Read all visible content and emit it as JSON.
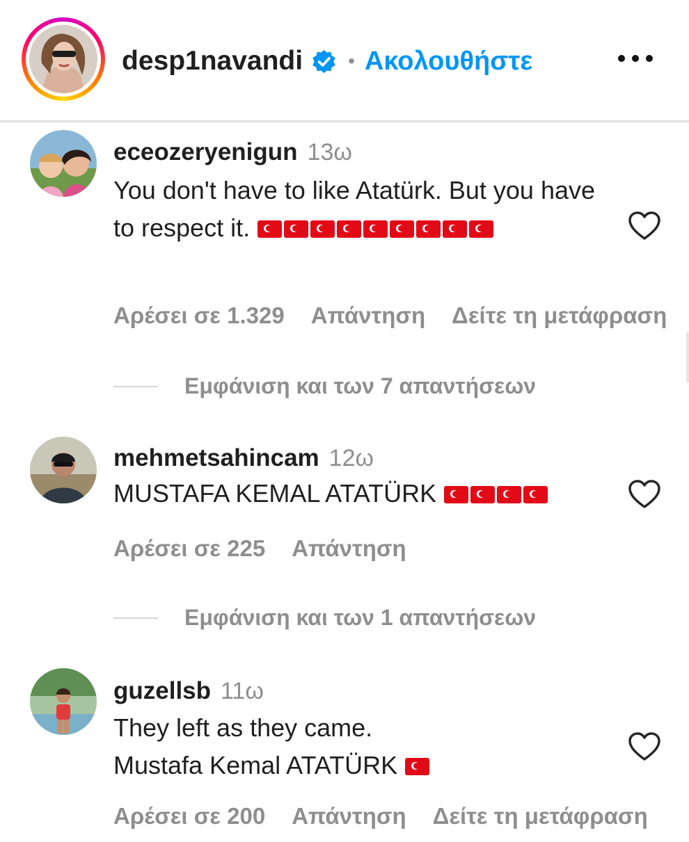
{
  "post_header": {
    "author": "desp1navandi",
    "dot": "•",
    "follow_label": "Ακολουθήστε",
    "more_icon": "more-horizontal-icon",
    "verified_icon": "verified-badge-icon",
    "story_ring_colors": [
      "#d300c5",
      "#ff0069",
      "#ff7a00",
      "#ffd600"
    ]
  },
  "colors": {
    "accent_blue": "#0095f6",
    "muted_text": "#8e8e8e",
    "flag_red": "#e30a17"
  },
  "comments": [
    {
      "username": "eceozeryenigun",
      "time": "13ω",
      "text": "You don't have to like Atatürk. But you have to respect it.",
      "flag_count": 9,
      "likes_label": "Αρέσει σε 1.329",
      "reply_label": "Απάντηση",
      "translate_label": "Δείτε τη μετάφραση",
      "view_replies_label": "Εμφάνιση και των 7 απαντήσεων"
    },
    {
      "username": "mehmetsahincam",
      "time": "12ω",
      "text": "MUSTAFA KEMAL ATATÜRK",
      "flag_count": 4,
      "likes_label": "Αρέσει σε 225",
      "reply_label": "Απάντηση",
      "view_replies_label": "Εμφάνιση και των 1 απαντήσεων"
    },
    {
      "username": "guzellsb",
      "time": "11ω",
      "text_line1": "They left as they came.",
      "text_line2": "Mustafa Kemal ATATÜRK",
      "flag_count": 1,
      "likes_label": "Αρέσει σε 200",
      "reply_label": "Απάντηση",
      "translate_label": "Δείτε τη μετάφραση"
    }
  ]
}
